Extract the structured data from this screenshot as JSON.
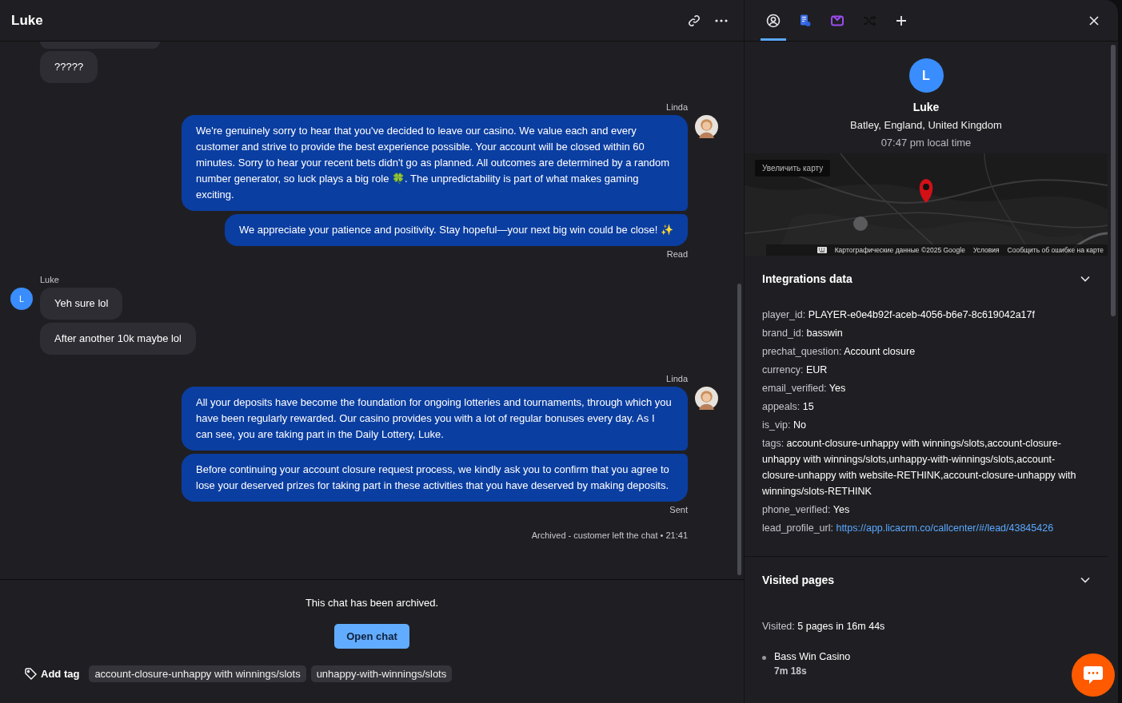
{
  "chat": {
    "title": "Luke",
    "groups": [
      {
        "kind": "visitor",
        "clipped_above": true,
        "messages": [
          "?????"
        ]
      },
      {
        "kind": "agent",
        "author": "Linda",
        "messages": [
          "We're genuinely sorry to hear that you've decided to leave our casino. We value each and every customer and strive to provide the best experience possible. Your account will be closed within 60 minutes. Sorry to hear your recent bets didn't go as planned. All outcomes are determined by a random number generator, so luck plays a big role 🍀. The unpredictability is part of what makes gaming exciting.",
          "We appreciate your patience and positivity. Stay hopeful—your next big win could be close! ✨"
        ],
        "status": "Read"
      },
      {
        "kind": "visitor",
        "author": "Luke",
        "avatar": "L",
        "messages": [
          "Yeh sure lol",
          "After another 10k maybe lol"
        ]
      },
      {
        "kind": "agent",
        "author": "Linda",
        "messages": [
          "All your deposits have become the foundation for ongoing lotteries and tournaments, through which you have been regularly rewarded. Our casino provides you with a lot of regular bonuses every day. As I can see, you are taking part in the Daily Lottery, Luke.",
          "Before continuing your account closure request process, we kindly ask you to confirm that you agree to lose your deserved prizes for taking part in these activities that you have deserved by making deposits."
        ],
        "status": "Sent"
      }
    ],
    "system_note": {
      "text": "Archived - customer left the chat",
      "separator": "•",
      "time": "21:41"
    },
    "archived_notice": "This chat has been archived.",
    "open_button": "Open chat",
    "add_tag": "Add tag",
    "tags": [
      "account-closure-unhappy with winnings/slots",
      "unhappy-with-winnings/slots"
    ]
  },
  "details": {
    "tabs": [
      {
        "kind": "user",
        "selected": true
      },
      {
        "kind": "document",
        "selected": false
      },
      {
        "kind": "inbox",
        "selected": false
      },
      {
        "kind": "shuffle",
        "selected": false
      },
      {
        "kind": "plus",
        "selected": false
      }
    ],
    "profile": {
      "initial": "L",
      "name": "Luke",
      "location": "Batley, England, United Kingdom",
      "local_time": "07:47 pm local time"
    },
    "map": {
      "kind": "picture",
      "zoom_tooltip": "Увеличить карту",
      "attribution": "Картографические данные ©2025 Google",
      "terms": "Условия",
      "report": "Сообщить об ошибке на карте"
    },
    "integrations": {
      "title": "Integrations data",
      "fields": [
        {
          "key": "player_id:",
          "value": "PLAYER-e0e4b92f-aceb-4056-b6e7-8c619042a17f",
          "kind": "text"
        },
        {
          "key": "brand_id:",
          "value": "basswin",
          "kind": "text"
        },
        {
          "key": "prechat_question:",
          "value": "Account closure",
          "kind": "text"
        },
        {
          "key": "currency:",
          "value": "EUR",
          "kind": "text"
        },
        {
          "key": "email_verified:",
          "value": "Yes",
          "kind": "text"
        },
        {
          "key": "appeals:",
          "value": "15",
          "kind": "text"
        },
        {
          "key": "is_vip:",
          "value": "No",
          "kind": "text"
        },
        {
          "key": "tags:",
          "value": "account-closure-unhappy with winnings/slots,account-closure-unhappy with winnings/slots,unhappy-with-winnings/slots,account-closure-unhappy with website-RETHINK,account-closure-unhappy with winnings/slots-RETHINK",
          "kind": "text"
        },
        {
          "key": "phone_verified:",
          "value": "Yes",
          "kind": "text"
        },
        {
          "key": "lead_profile_url:",
          "value": "https://app.licacrm.co/callcenter/#/lead/43845426",
          "kind": "link"
        }
      ]
    },
    "visited": {
      "title": "Visited pages",
      "summary_label": "Visited:",
      "summary_value": "5 pages in 16m 44s",
      "pages": [
        {
          "title": "Bass Win Casino",
          "duration": "7m 18s"
        }
      ]
    }
  }
}
